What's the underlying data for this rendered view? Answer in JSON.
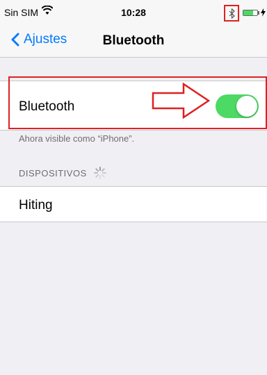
{
  "status_bar": {
    "carrier": "Sin SIM",
    "time": "10:28",
    "wifi_icon": "wifi-icon",
    "bluetooth_icon": "bluetooth-icon",
    "battery_icon": "battery-icon",
    "battery_level": 0.7
  },
  "nav": {
    "back_label": "Ajustes",
    "title": "Bluetooth"
  },
  "bluetooth_setting": {
    "label": "Bluetooth",
    "enabled": true,
    "footer": "Ahora visible como “iPhone”."
  },
  "devices": {
    "header": "DISPOSITIVOS",
    "items": [
      {
        "name": "Hiting"
      }
    ]
  },
  "colors": {
    "accent": "#007aff",
    "toggle_on": "#4cd964",
    "annotation": "#e02020",
    "background": "#efeff4"
  }
}
